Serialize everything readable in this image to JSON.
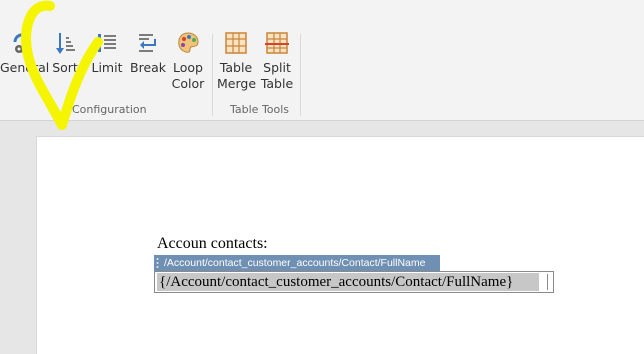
{
  "ribbon": {
    "buttons": {
      "general": "General",
      "sort": "Sort",
      "limit": "Limit",
      "break": "Break",
      "loop_color_1": "Loop",
      "loop_color_2": "Color",
      "table_merge_1": "Table",
      "table_merge_2": "Merge",
      "split_table_1": "Split",
      "split_table_2": "Table"
    },
    "groups": {
      "configuration": "Configuration",
      "table_tools": "Table Tools"
    }
  },
  "document": {
    "heading": "Accoun contacts:",
    "tag_label": "/Account/contact_customer_accounts/Contact/FullName",
    "field_value": "{/Account/contact_customer_accounts/Contact/FullName}"
  },
  "annotation": {
    "color": "#f5f500"
  }
}
